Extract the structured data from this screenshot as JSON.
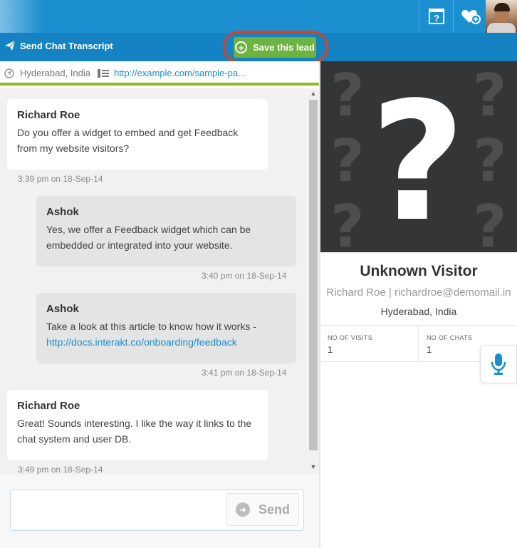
{
  "header": {
    "icons": [
      "help-icon",
      "favorite-add-icon",
      "avatar"
    ]
  },
  "toolbar": {
    "send_transcript_label": "Send Chat Transcript",
    "save_lead_label": "Save this lead",
    "save_lead_color": "#6db33f"
  },
  "info": {
    "location": "Hyderabad, India",
    "url": "http://example.com/sample-pa..."
  },
  "messages": [
    {
      "sender": "Richard Roe",
      "role": "visitor",
      "lines": [
        "Do you offer a widget to embed and get Feedback",
        "from my website visitors?"
      ],
      "time": "3:39 pm on 18-Sep-14"
    },
    {
      "sender": "Ashok",
      "role": "agent",
      "lines": [
        "Yes, we offer a Feedback widget which can be",
        "embedded or integrated into your website."
      ],
      "time": "3:40 pm on 18-Sep-14"
    },
    {
      "sender": "Ashok",
      "role": "agent",
      "text": "Take a look at this article to know how it works -",
      "link": "http://docs.interakt.co/onboarding/feedback",
      "time": "3:41 pm on 18-Sep-14"
    },
    {
      "sender": "Richard Roe",
      "role": "visitor",
      "lines": [
        "Great! Sounds interesting. I like the way it links to the",
        "chat system and user DB."
      ],
      "time": "3:49 pm on 18-Sep-14"
    }
  ],
  "composer": {
    "send_label": "Send",
    "placeholder": ""
  },
  "visitor": {
    "title": "Unknown Visitor",
    "name_email": "Richard Roe | richardroe@demomail.in",
    "city": "Hyderabad, India",
    "stats": [
      {
        "label": "NO OF VISITS",
        "value": "1"
      },
      {
        "label": "NO OF CHATS",
        "value": "1"
      }
    ]
  },
  "colors": {
    "topbar": "#1b8fd0",
    "actionbar": "#1583c3",
    "accent_green": "#8dbb1f",
    "link": "#1a8fcf",
    "highlight": "#e0401a"
  }
}
